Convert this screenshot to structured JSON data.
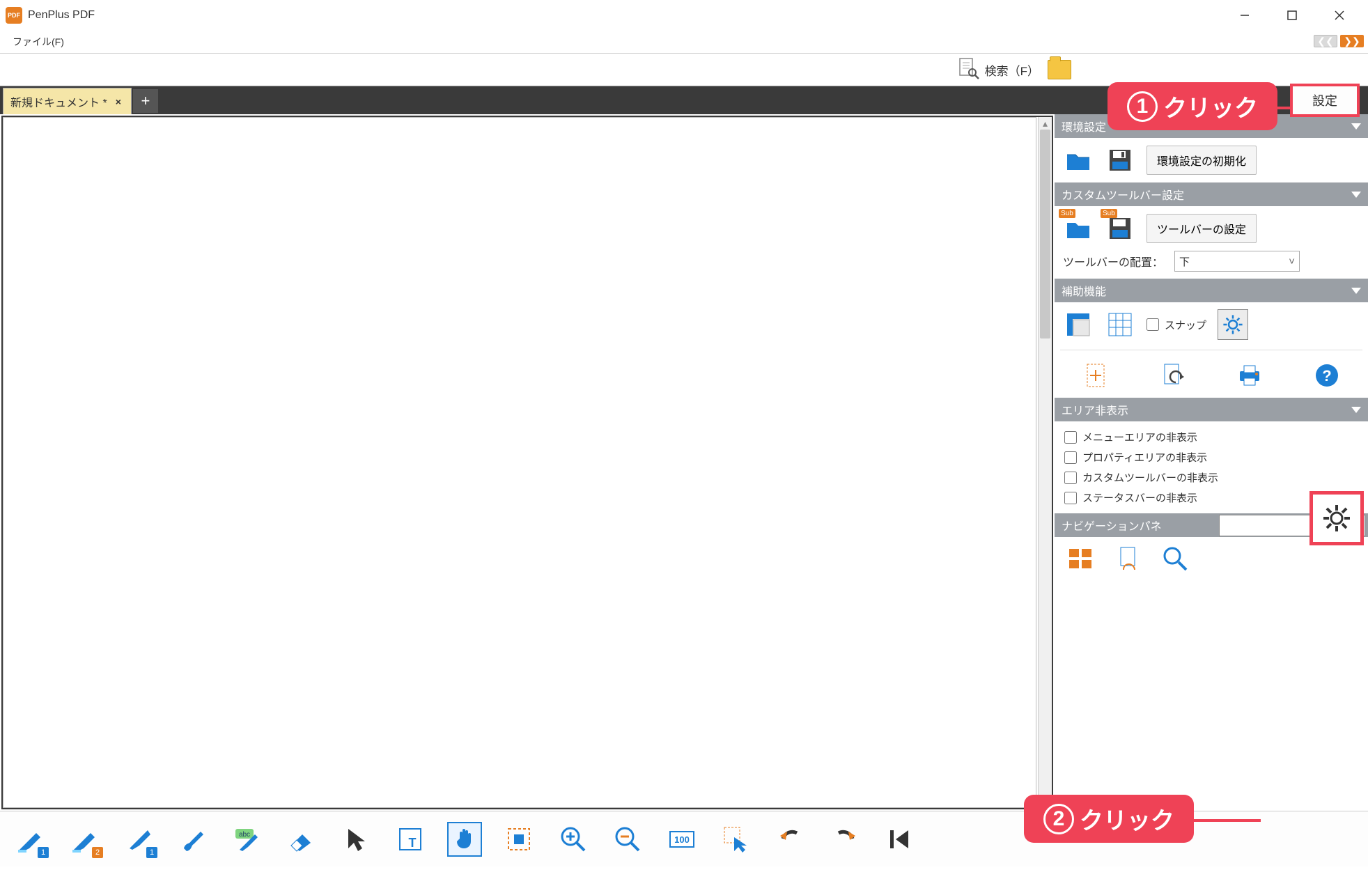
{
  "titlebar": {
    "title": "PenPlus PDF"
  },
  "menubar": {
    "file": "ファイル(F)"
  },
  "upperbar": {
    "search_label": "検索（F）",
    "settings_label": "設定"
  },
  "callouts": {
    "c1_num": "1",
    "c1_text": "クリック",
    "c2_num": "2",
    "c2_text": "クリック"
  },
  "tab": {
    "name": "新規ドキュメント *",
    "close": "×",
    "plus": "+"
  },
  "rpanel": {
    "env_header": "環境設定",
    "env_reset": "環境設定の初期化",
    "custom_header": "カスタムツールバー設定",
    "toolbar_settings": "ツールバーの設定",
    "toolbar_pos_label": "ツールバーの配置：",
    "toolbar_pos_value": "下",
    "assist_header": "補助機能",
    "snap_label": "スナップ",
    "area_header": "エリア非表示",
    "chk_menu": "メニューエリアの非表示",
    "chk_prop": "プロパティエリアの非表示",
    "chk_custom": "カスタムツールバーの非表示",
    "chk_status": "ステータスバーの非表示",
    "nav_header": "ナビゲーションパネ",
    "nav_tooltip": "ステータスバーの非表示",
    "sub_badge": "Sub"
  },
  "lowtoolbar": {
    "b1": "1",
    "b2": "2",
    "b3": "1",
    "one_hundred": "100"
  }
}
